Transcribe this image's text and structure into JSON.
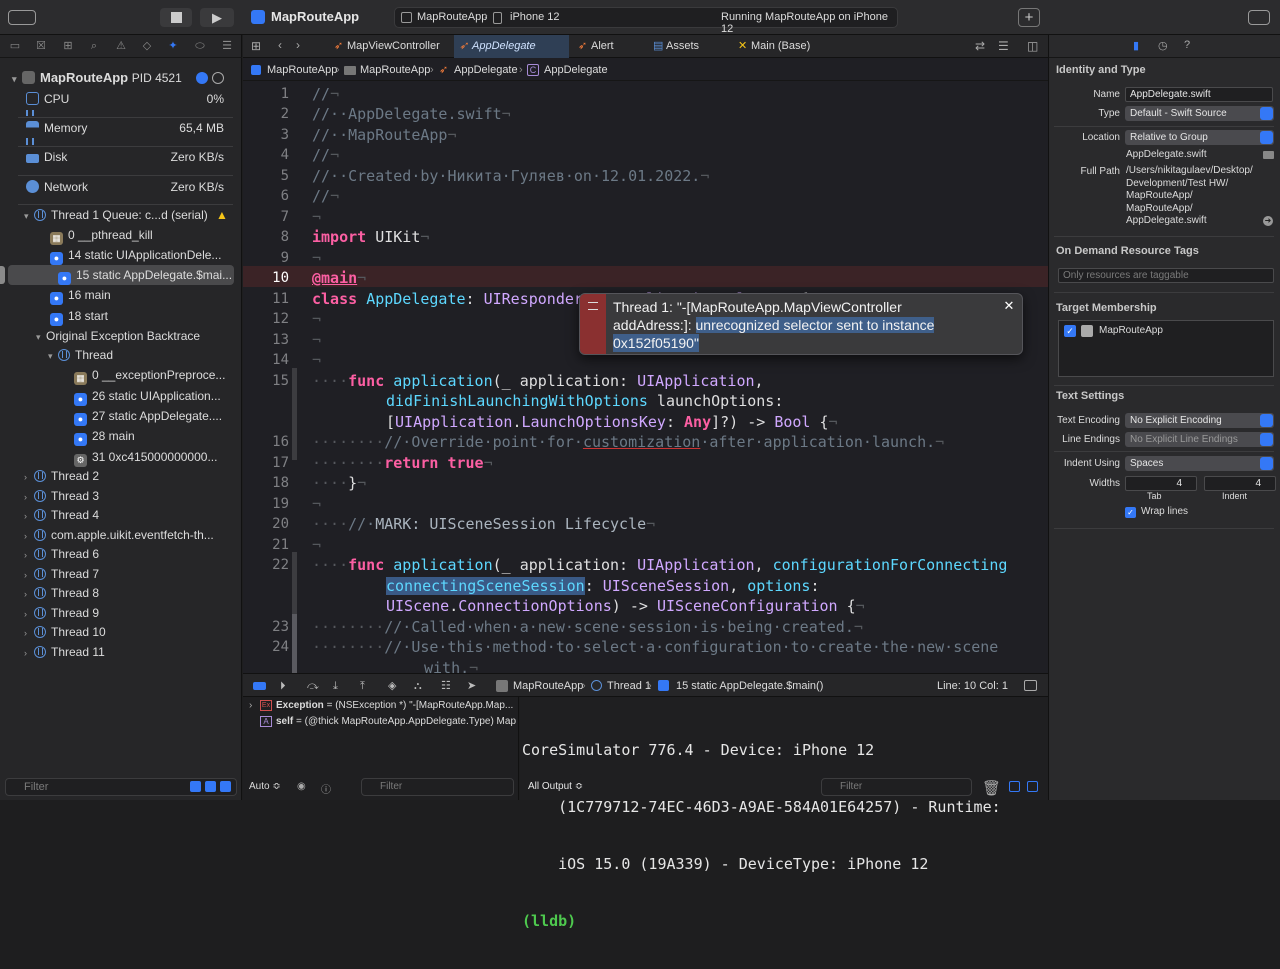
{
  "toolbar": {
    "app_name": "MapRouteApp",
    "scheme": "MapRouteApp",
    "device": "iPhone 12",
    "status": "Running MapRouteApp on iPhone 12"
  },
  "debug_nav": {
    "process": {
      "name": "MapRouteApp",
      "pid": "PID 4521"
    },
    "gauges": [
      {
        "label": "CPU",
        "value": "0%"
      },
      {
        "label": "Memory",
        "value": "65,4 MB"
      },
      {
        "label": "Disk",
        "value": "Zero KB/s"
      },
      {
        "label": "Network",
        "value": "Zero KB/s"
      }
    ],
    "thread1": "Thread 1 Queue: c...d (serial)",
    "frames": [
      "0 __pthread_kill",
      "14 static UIApplicationDele...",
      "15 static AppDelegate.$mai...",
      "16 main",
      "18 start"
    ],
    "backtrace_title": "Original Exception Backtrace",
    "backtrace_thread": "Thread",
    "backtrace_frames": [
      "0 __exceptionPreproce...",
      "26 static UIApplication...",
      "27 static AppDelegate....",
      "28 main",
      "31 0xc415000000000..."
    ],
    "threads": [
      "Thread 2",
      "Thread 3",
      "Thread 4",
      "com.apple.uikit.eventfetch-th...",
      "Thread 6",
      "Thread 7",
      "Thread 8",
      "Thread 9",
      "Thread 10",
      "Thread 11"
    ],
    "filter_placeholder": "Filter"
  },
  "tabs": [
    "MapViewController",
    "AppDelegate",
    "Alert",
    "Assets",
    "Main (Base)"
  ],
  "jump": [
    "MapRouteApp",
    "MapRouteApp",
    "AppDelegate",
    "AppDelegate"
  ],
  "code_lines": [
    "1",
    "2",
    "3",
    "4",
    "5",
    "6",
    "7",
    "8",
    "9",
    "10",
    "11",
    "12",
    "13",
    "14",
    "15",
    "",
    "",
    "16",
    "17",
    "18",
    "19",
    "20",
    "21",
    "22",
    "",
    "",
    "23",
    "24",
    ""
  ],
  "error": {
    "text1": "Thread 1: \"-[MapRouteApp.MapViewController",
    "text2": "addAdress:]: ",
    "text2_hl": "unrecognized selector sent to instance",
    "text3": "0x152f05190\""
  },
  "debugbar": {
    "app": "MapRouteApp",
    "thread": "Thread 1",
    "frame": "15 static AppDelegate.$main()",
    "position": "Line: 10  Col: 1"
  },
  "vars": [
    {
      "name": "Exception",
      "value": "= (NSException *) \"-[MapRouteApp.Map..."
    },
    {
      "name": "self",
      "value": "= (@thick MapRouteApp.AppDelegate.Type) Map..."
    }
  ],
  "vars_footer": {
    "auto": "Auto ≎",
    "filter": "Filter"
  },
  "console": {
    "lines": [
      "CoreSimulator 776.4 - Device: iPhone 12",
      "    (1C779712-74EC-46D3-A9AE-584A01E64257) - Runtime:",
      "    iOS 15.0 (19A339) - DeviceType: iPhone 12"
    ],
    "prompt": "(lldb)",
    "output_select": "All Output ≎",
    "filter": "Filter"
  },
  "inspector": {
    "identity_title": "Identity and Type",
    "name_label": "Name",
    "name": "AppDelegate.swift",
    "type_label": "Type",
    "type": "Default - Swift Source",
    "location_label": "Location",
    "location": "Relative to Group",
    "location_file": "AppDelegate.swift",
    "fullpath_label": "Full Path",
    "fullpath": [
      "/Users/nikitagulaev/Desktop/",
      "Development/Test HW/",
      "MapRouteApp/",
      "MapRouteApp/",
      "AppDelegate.swift"
    ],
    "odr_title": "On Demand Resource Tags",
    "odr_placeholder": "Only resources are taggable",
    "target_title": "Target Membership",
    "target": "MapRouteApp",
    "text_title": "Text Settings",
    "encoding_label": "Text Encoding",
    "encoding": "No Explicit Encoding",
    "endings_label": "Line Endings",
    "endings": "No Explicit Line Endings",
    "indent_label": "Indent Using",
    "indent": "Spaces",
    "widths_label": "Widths",
    "tab_width": "4",
    "indent_width": "4",
    "tab_label": "Tab",
    "indent_sub": "Indent",
    "wrap": "Wrap lines"
  }
}
